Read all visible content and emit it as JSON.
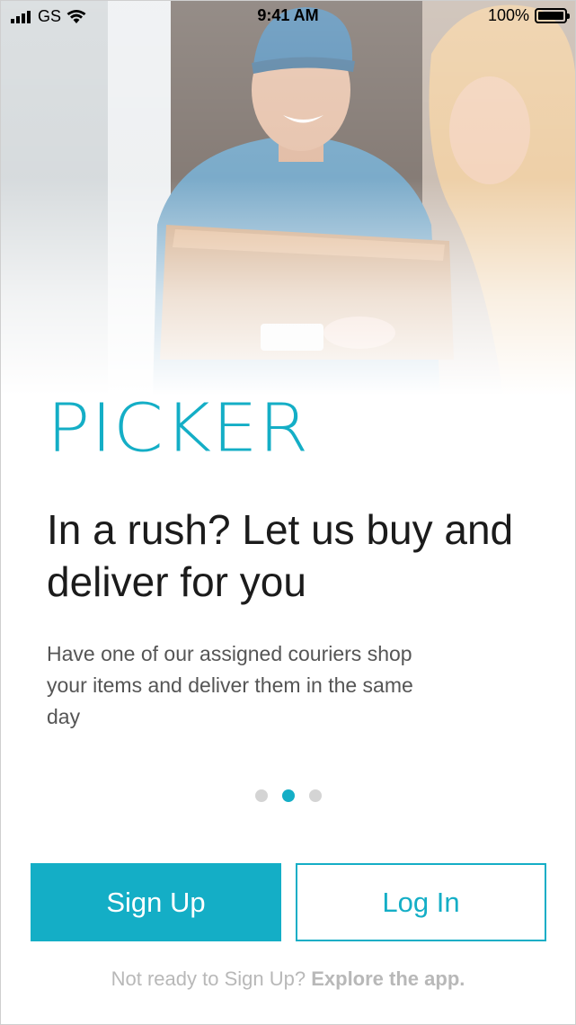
{
  "status_bar": {
    "carrier": "GS",
    "time": "9:41 AM",
    "battery": "100%",
    "icons": [
      "signal-icon",
      "wifi-icon",
      "battery-icon"
    ]
  },
  "onboarding": {
    "brand": "PICKER",
    "headline": "In a rush? Let us buy and deliver for you",
    "subtext": "Have one of our assigned couriers shop your items and deliver them in the same day",
    "pager": {
      "count": 3,
      "active_index": 1
    }
  },
  "actions": {
    "sign_up_label": "Sign Up",
    "log_in_label": "Log In"
  },
  "footer": {
    "prompt": "Not ready to Sign Up?",
    "explore_label": "Explore the app."
  },
  "colors": {
    "accent": "#14aec6",
    "text_dark": "#1b1b1b",
    "text_muted": "#555555",
    "footer_text": "#b8b8b8",
    "dot_inactive": "#d4d4d4"
  }
}
